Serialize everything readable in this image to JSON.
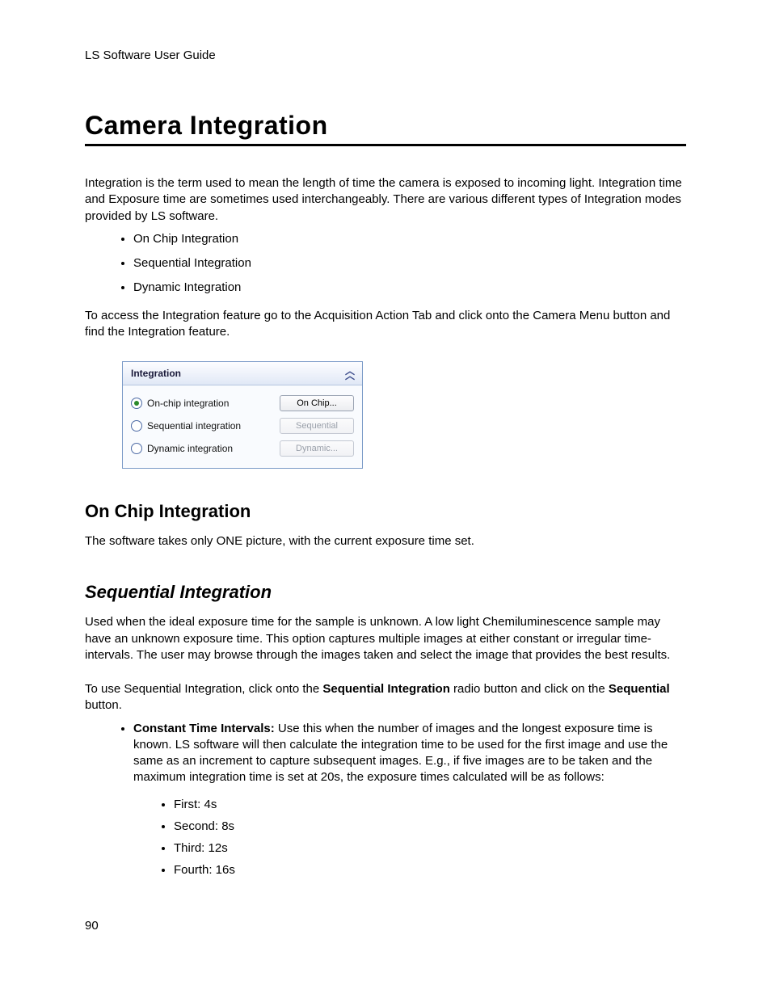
{
  "header": {
    "doc_title": "LS Software User Guide"
  },
  "chapter": {
    "title": "Camera Integration"
  },
  "intro": {
    "p1": "Integration is the term used to mean the length of time the camera is exposed to incoming light. Integration time and Exposure time are sometimes used interchangeably. There are various different types of Integration modes provided by LS software.",
    "bullets": [
      "On Chip Integration",
      "Sequential Integration",
      "Dynamic Integration"
    ],
    "p2": "To access the Integration feature go to the Acquisition Action Tab and click onto the Camera Menu button and find the Integration feature."
  },
  "panel": {
    "title": "Integration",
    "rows": [
      {
        "label": "On-chip integration",
        "selected": true,
        "button": "On Chip...",
        "enabled": true
      },
      {
        "label": "Sequential integration",
        "selected": false,
        "button": "Sequential",
        "enabled": false
      },
      {
        "label": "Dynamic integration",
        "selected": false,
        "button": "Dynamic...",
        "enabled": false
      }
    ]
  },
  "onchip": {
    "heading": "On Chip Integration",
    "p1": "The software takes only ONE picture, with the current exposure time set."
  },
  "sequential": {
    "heading": "Sequential Integration",
    "p1": "Used when the ideal exposure time for the sample is unknown. A low light Chemiluminescence sample may have an unknown exposure time. This option captures multiple images at either constant or irregular time-intervals. The user may browse through the images taken and select the image that provides the best results.",
    "p2_a": "To use Sequential Integration, click onto the ",
    "p2_b": "Sequential Integration",
    "p2_c": " radio button and click on the ",
    "p2_d": "Sequential",
    "p2_e": " button.",
    "constant_label": "Constant Time Intervals:",
    "constant_text": " Use this when the number of images and the longest exposure time is known. LS software will then calculate the integration time to be used for the first image and use the same as an increment to capture subsequent images. E.g., if five images are to be taken and the maximum integration time is set at 20s, the exposure times calculated will be as follows:",
    "times": [
      "First: 4s",
      "Second: 8s",
      "Third: 12s",
      "Fourth: 16s"
    ]
  },
  "page_number": "90"
}
